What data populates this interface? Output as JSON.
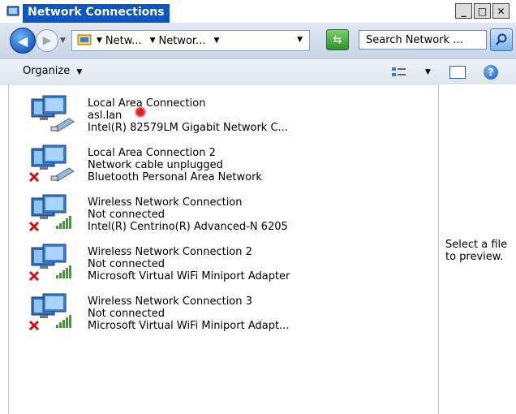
{
  "window": {
    "title": "Network Connections"
  },
  "caption_buttons": {
    "minimize": "_",
    "maximize": "□",
    "close": "✕"
  },
  "address": {
    "crumbs": [
      "Netw...",
      "Networ..."
    ],
    "search_placeholder": "Search Network ..."
  },
  "toolbar": {
    "organize_label": "Organize"
  },
  "connections": [
    {
      "name": "Local Area Connection",
      "status": "asl.lan",
      "device": "Intel(R) 82579LM Gigabit Network C...",
      "kind": "wired",
      "disabled": false
    },
    {
      "name": "Local Area Connection 2",
      "status": "Network cable unplugged",
      "device": "Bluetooth Personal Area Network",
      "kind": "wired",
      "disabled": true
    },
    {
      "name": "Wireless Network Connection",
      "status": "Not connected",
      "device": "Intel(R) Centrino(R) Advanced-N 6205",
      "kind": "wireless",
      "disabled": true
    },
    {
      "name": "Wireless Network Connection 2",
      "status": "Not connected",
      "device": "Microsoft Virtual WiFi Miniport Adapter",
      "kind": "wireless",
      "disabled": true
    },
    {
      "name": "Wireless Network Connection 3",
      "status": "Not connected",
      "device": "Microsoft Virtual WiFi Miniport Adapt...",
      "kind": "wireless",
      "disabled": true
    }
  ],
  "preview": {
    "text": "Select a file to preview."
  },
  "colors": {
    "title_bar": "#0b56c0",
    "error": "#d01010",
    "signal": "#3aa52a"
  }
}
